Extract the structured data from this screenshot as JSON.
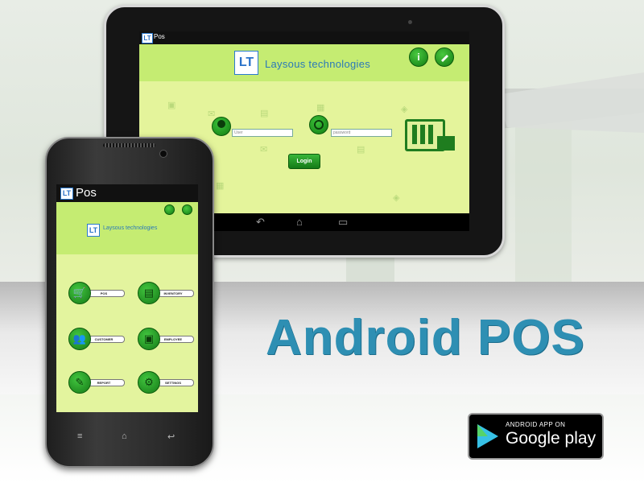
{
  "headline": "Android POS",
  "tablet": {
    "titlebar_logo": "LT",
    "app_title": "Pos",
    "header_logo": "LT",
    "company_name": "Laysous technologies",
    "info_icon": "i",
    "user_placeholder": "User",
    "password_placeholder": "password",
    "login_label": "Login",
    "nav": {
      "back": "↶",
      "home": "⌂",
      "recent": "▭"
    }
  },
  "phone": {
    "titlebar_logo": "LT",
    "app_title": "Pos",
    "header_logo": "LT",
    "company_name": "Laysous technologies",
    "menu": [
      {
        "label": "POS",
        "icon": "cart-icon",
        "glyph": "🛒"
      },
      {
        "label": "INVENTORY",
        "icon": "document-icon",
        "glyph": "▤"
      },
      {
        "label": "CUSTOMER",
        "icon": "users-icon",
        "glyph": "👥"
      },
      {
        "label": "EMPLOYEE",
        "icon": "badge-icon",
        "glyph": "▣"
      },
      {
        "label": "REPORT",
        "icon": "report-icon",
        "glyph": "✎"
      },
      {
        "label": "SETTINGS",
        "icon": "gear-icon",
        "glyph": "⚙"
      }
    ],
    "nav": {
      "menu": "≡",
      "home": "⌂",
      "back": "↩"
    }
  },
  "google_play": {
    "small_text": "ANDROID APP ON",
    "big_text": "Google play"
  },
  "colors": {
    "screen_bg": "#e3f49e",
    "header_bg": "#c5ec72",
    "button_green": "#1a8a1a",
    "headline_blue": "#2e8fb3",
    "logo_blue": "#2a79b8"
  }
}
